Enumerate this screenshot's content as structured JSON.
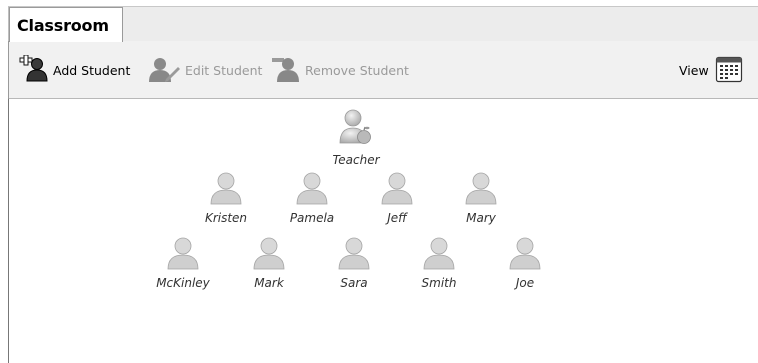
{
  "tabs": [
    {
      "label": "Classroom",
      "active": true
    }
  ],
  "toolbar": {
    "add_label": "Add Student",
    "edit_label": "Edit Student",
    "remove_label": "Remove Student",
    "view_label": "View"
  },
  "classroom": {
    "teacher": {
      "name": "Teacher"
    },
    "rows": [
      [
        "Kristen",
        "Pamela",
        "Jeff",
        "Mary"
      ],
      [
        "McKinley",
        "Mark",
        "Sara",
        "Smith",
        "Joe"
      ]
    ]
  },
  "icons": {
    "add": "add-student-icon",
    "edit": "edit-student-icon",
    "remove": "remove-student-icon",
    "view": "calendar-grid-icon",
    "person": "person-icon",
    "teacher": "teacher-apple-icon"
  },
  "colors": {
    "tab_border": "#9a9a9a",
    "disabled_text": "#9a9a9a",
    "person_icon": "#c4c4c4"
  }
}
